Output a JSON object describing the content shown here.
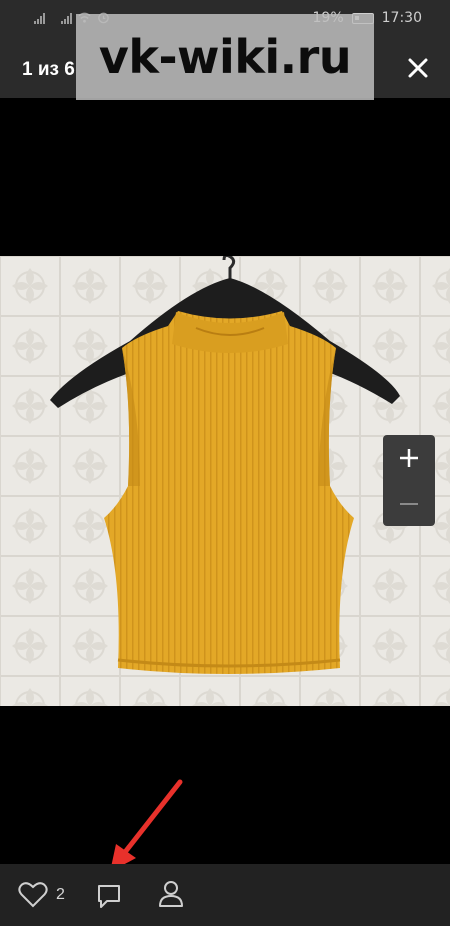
{
  "status_bar": {
    "battery_percent": "19%",
    "time": "17:30",
    "icons": [
      "signal-icon",
      "signal-icon",
      "wifi-icon",
      "alarm-icon",
      "battery-icon"
    ]
  },
  "header": {
    "counter": "1 из 6",
    "close_icon": "close-icon"
  },
  "watermark": {
    "text": "vk-wiki.ru"
  },
  "photo": {
    "subject": "yellow ribbed sleeveless crop top on black hanger"
  },
  "zoom": {
    "in_icon": "plus-icon",
    "out_icon": "minus-icon"
  },
  "bottom_bar": {
    "like_icon": "heart-icon",
    "like_count": "2",
    "comment_icon": "comment-icon",
    "tag_icon": "person-icon"
  },
  "annotation": {
    "arrow_color": "#e8312b"
  },
  "colors": {
    "bar_bg": "#2b2b2b",
    "bottom_bg": "#222222",
    "shirt": "#e3a827"
  }
}
